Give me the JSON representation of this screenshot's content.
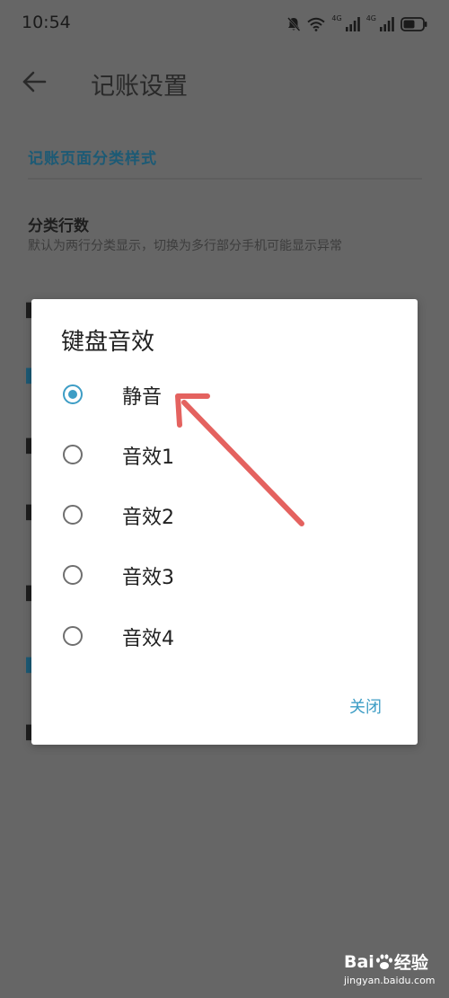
{
  "status_bar": {
    "time": "10:54",
    "network_label_1": "4G",
    "network_label_2": "4G",
    "icons": [
      "mute-bell-icon",
      "wifi-icon",
      "signal-icon",
      "signal-icon",
      "battery-icon"
    ]
  },
  "app_bar": {
    "back_icon": "arrow-left-icon",
    "title": "记账设置"
  },
  "settings": {
    "section_header": "记账页面分类样式",
    "item_title": "分类行数",
    "item_description": "默认为两行分类显示，切换为多行部分手机可能显示异常"
  },
  "dialog": {
    "title": "键盘音效",
    "options": [
      {
        "label": "静音",
        "checked": true
      },
      {
        "label": "音效1",
        "checked": false
      },
      {
        "label": "音效2",
        "checked": false
      },
      {
        "label": "音效3",
        "checked": false
      },
      {
        "label": "音效4",
        "checked": false
      }
    ],
    "close_label": "关闭"
  },
  "colors": {
    "scrim_background": "#666666",
    "accent": "#3d9dc5",
    "section_header": "#1c5a75",
    "annotation_arrow": "#e4625f"
  },
  "watermark": {
    "brand_prefix": "Bai",
    "brand_suffix": "经验",
    "site": "jingyan.baidu.com"
  }
}
